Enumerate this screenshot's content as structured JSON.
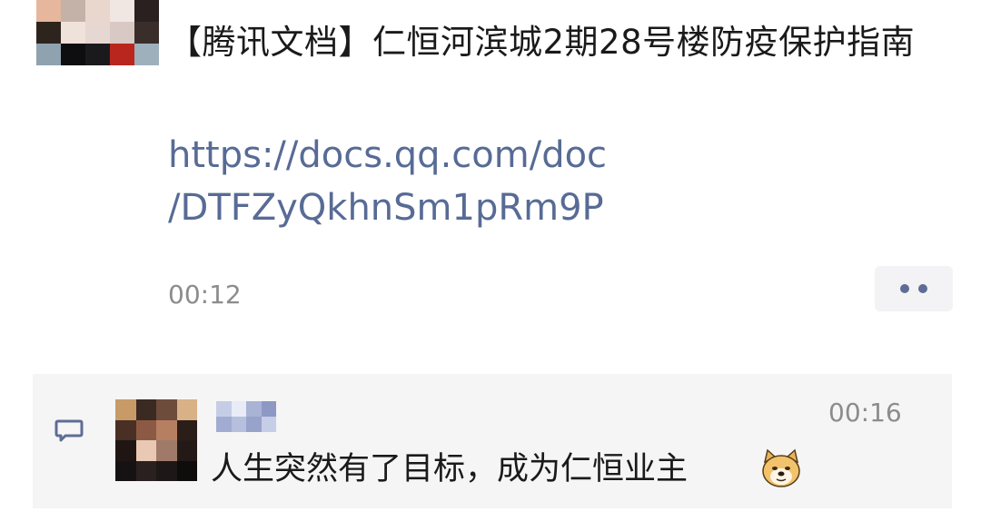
{
  "post": {
    "title": "【腾讯文档】仁恒河滨城2期28号楼防疫保护指南",
    "link_line1": "https://docs.qq.com/doc",
    "link_line2": "/DTFZyQkhnSm1pRm9P",
    "time": "00:12"
  },
  "comment": {
    "text": "人生突然有了目标，成为仁恒业主",
    "time": "00:16",
    "emoji": "doge-emoji"
  },
  "icons": {
    "more": "more-dots-icon",
    "comment": "comment-bubble-icon"
  },
  "colors": {
    "link": "#576b95",
    "timestamp": "#8c8c8c",
    "comment_bg": "#f5f5f5"
  }
}
